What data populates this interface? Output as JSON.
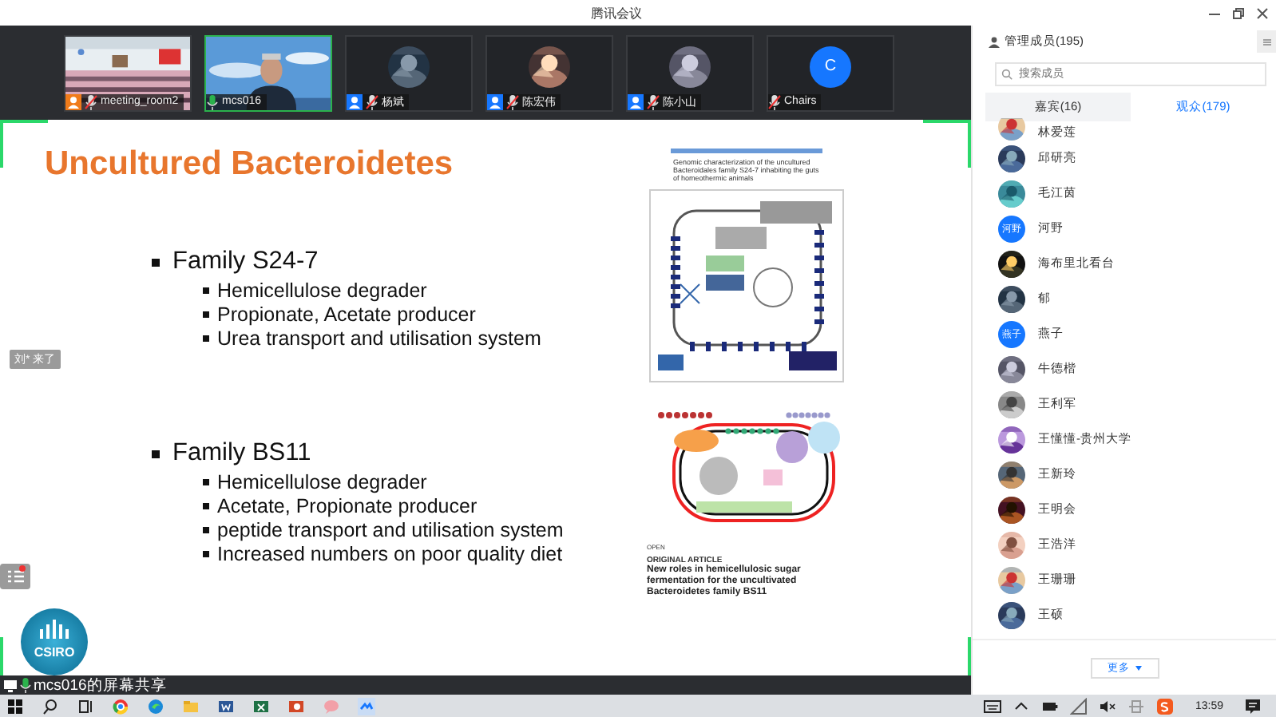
{
  "window": {
    "title": "腾讯会议"
  },
  "video_tiles": [
    {
      "kind": "room",
      "name": "meeting_room2",
      "color": "#f07b1a",
      "mic_on": false,
      "speaking": false
    },
    {
      "kind": "outdoor",
      "name": "mcs016",
      "mic_on": true,
      "speaking": true
    },
    {
      "kind": "avatar",
      "name": "杨斌",
      "color": "#1677ff",
      "mic_on": false,
      "speaking": false
    },
    {
      "kind": "avatar",
      "name": "陈宏伟",
      "color": "#1677ff",
      "mic_on": false,
      "speaking": false
    },
    {
      "kind": "avatar",
      "name": "陈小山",
      "color": "#1677ff",
      "mic_on": false,
      "speaking": false
    },
    {
      "kind": "letter",
      "avatar_text": "C",
      "name": "Chairs",
      "mic_on": false,
      "speaking": false
    }
  ],
  "slide": {
    "title": "Uncultured Bacteroidetes",
    "sections": [
      {
        "heading": "Family S24-7",
        "points": [
          "Hemicellulose degrader",
          "Propionate, Acetate producer",
          "Urea transport and utilisation system"
        ]
      },
      {
        "heading": "Family BS11",
        "points": [
          "Hemicellulose degrader",
          "Acetate, Propionate producer",
          "peptide transport and utilisation system",
          "Increased numbers on poor quality diet"
        ]
      }
    ],
    "paper_title": "Genomic characterization of the uncultured Bacteroidales family S24-7 inhabiting the guts of homeothermic animals",
    "article": {
      "tag": "OPEN",
      "type": "ORIGINAL ARTICLE",
      "title": "New roles in hemicellulosic sugar fermentation for the uncultivated Bacteroidetes family BS11"
    }
  },
  "toast": "刘* 来了",
  "logo_text": "CSIRO",
  "share_label": "mcs016的屏幕共享",
  "members": {
    "header": "管理成员(195)",
    "search": {
      "placeholder": "搜索成员"
    },
    "tabs": [
      {
        "label": "嘉宾(16)",
        "selected": false
      },
      {
        "label": "观众(179)",
        "selected": true
      }
    ],
    "list": [
      {
        "name": "林爱莲"
      },
      {
        "name": "邱研亮"
      },
      {
        "name": "毛江茵"
      },
      {
        "kind": "text",
        "avatar_text": "河野",
        "name": "河野"
      },
      {
        "name": "海布里北看台"
      },
      {
        "name": "郁"
      },
      {
        "kind": "text",
        "avatar_text": "燕子",
        "name": "燕子"
      },
      {
        "name": "牛德楷"
      },
      {
        "name": "王利军"
      },
      {
        "name": "王懂懂-贵州大学"
      },
      {
        "name": "王新玲"
      },
      {
        "name": "王明会"
      },
      {
        "name": "王浩洋"
      },
      {
        "name": "王珊珊"
      },
      {
        "name": "王硕"
      }
    ],
    "more_button": "更多"
  },
  "taskbar": {
    "clock": "13:59"
  }
}
